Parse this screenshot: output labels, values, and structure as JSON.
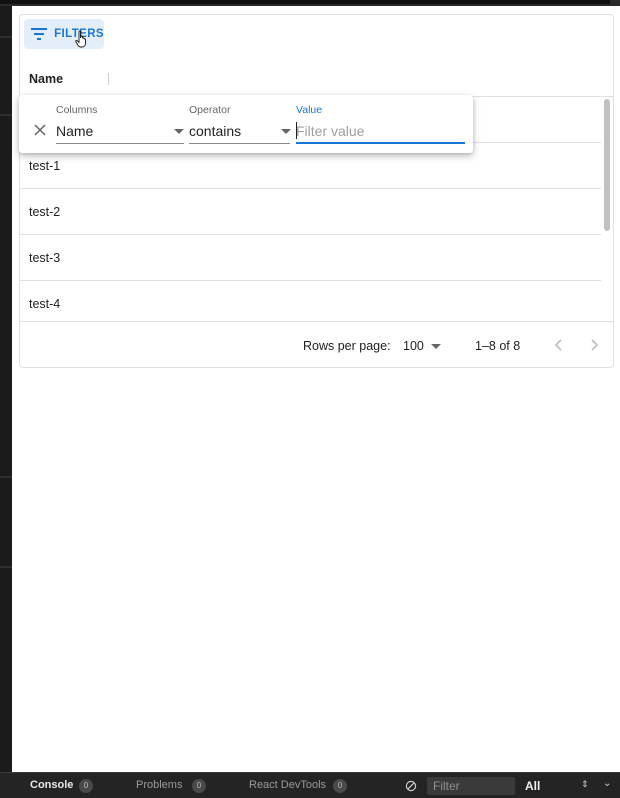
{
  "toolbar": {
    "filters_label": "FILTERS"
  },
  "grid": {
    "column_header": "Name",
    "rows": [
      "test-1",
      "test-2",
      "test-3",
      "test-4"
    ]
  },
  "filter_panel": {
    "columns_label": "Columns",
    "columns_value": "Name",
    "operator_label": "Operator",
    "operator_value": "contains",
    "value_label": "Value",
    "value_placeholder": "Filter value",
    "value_current": ""
  },
  "pagination": {
    "rows_per_page_label": "Rows per page:",
    "rows_per_page_value": "100",
    "range_text": "1–8 of 8"
  },
  "devtools": {
    "tabs": [
      {
        "label": "Console",
        "count": "0",
        "active": true
      },
      {
        "label": "Problems",
        "count": "0",
        "active": false
      },
      {
        "label": "React DevTools",
        "count": "0",
        "active": false
      }
    ],
    "filter_placeholder": "Filter",
    "level_value": "All"
  },
  "colors": {
    "accent": "#1976d2",
    "accent_bg": "#e3eefa",
    "border": "#e0e0e0",
    "frame": "#1e1e1e"
  },
  "icons": [
    "filter-list-icon",
    "pointer-cursor-icon",
    "close-icon",
    "chevron-left-icon",
    "chevron-right-icon",
    "dropdown-arrow-icon",
    "clear-console-icon"
  ]
}
